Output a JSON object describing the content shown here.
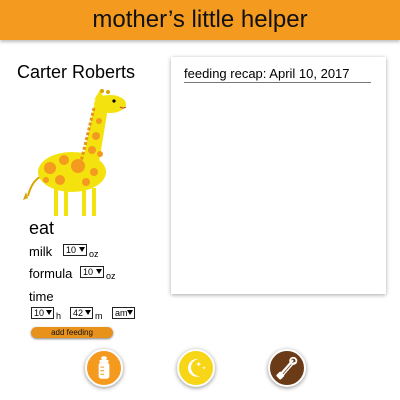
{
  "app": {
    "title": "mother’s little helper"
  },
  "child": {
    "name": "Carter Roberts"
  },
  "eat": {
    "title": "eat",
    "milk": {
      "label": "milk",
      "value": "10",
      "unit": "oz"
    },
    "formula": {
      "label": "formula",
      "value": "10",
      "unit": "oz"
    },
    "time": {
      "label": "time",
      "hour": "10",
      "hour_unit": "h",
      "minute": "42",
      "minute_unit": "m",
      "ampm": "am"
    },
    "add_button": "add feeding"
  },
  "recap": {
    "title": "feeding recap: April 10, 2017"
  },
  "nav": [
    {
      "icon": "bottle-icon",
      "color": "#f39a1f"
    },
    {
      "icon": "moon-stars-icon",
      "color": "#f7d617"
    },
    {
      "icon": "diaper-pin-icon",
      "color": "#6b3a16"
    }
  ],
  "colors": {
    "accent": "#f39a1f",
    "giraffe_body": "#f4e20f",
    "giraffe_spots": "#f39a1f"
  }
}
